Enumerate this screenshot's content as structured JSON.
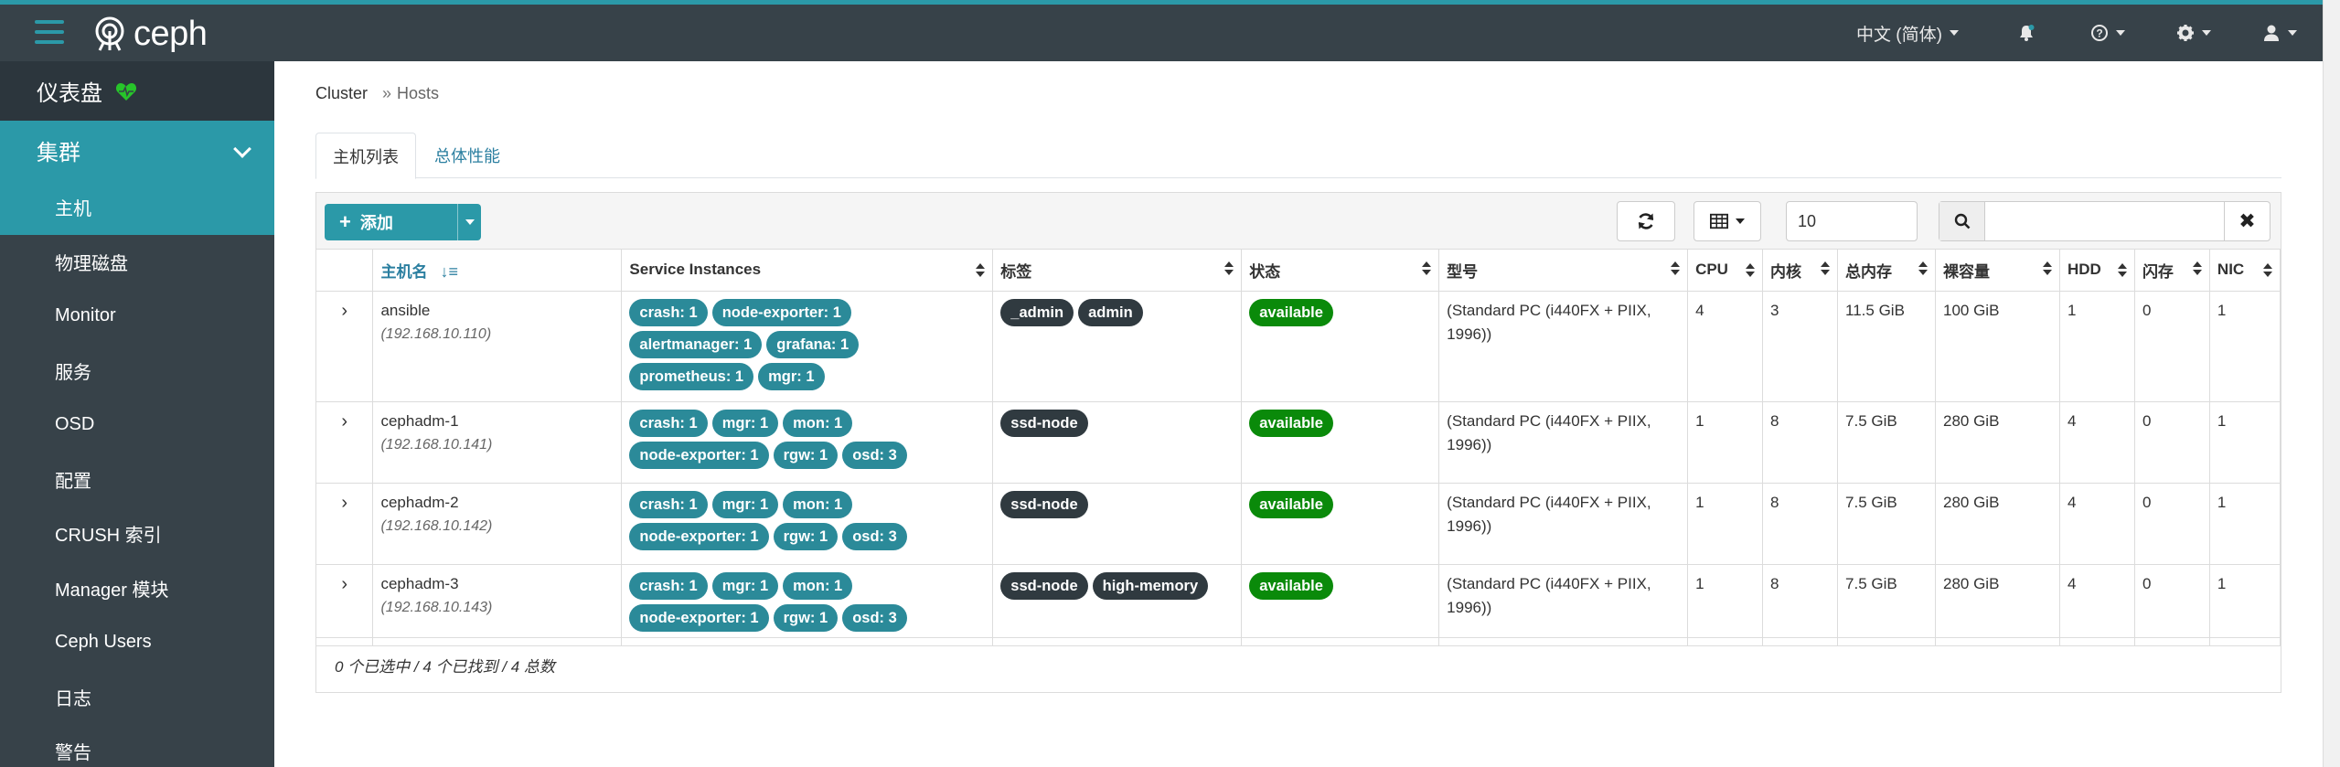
{
  "brand": {
    "name": "ceph"
  },
  "navbar": {
    "language": "中文 (简体)"
  },
  "sidebar": {
    "dashboard": "仪表盘",
    "cluster": "集群",
    "items": [
      {
        "label": "主机",
        "active": true
      },
      {
        "label": "物理磁盘"
      },
      {
        "label": "Monitor"
      },
      {
        "label": "服务"
      },
      {
        "label": "OSD"
      },
      {
        "label": "配置"
      },
      {
        "label": "CRUSH 索引"
      },
      {
        "label": "Manager 模块"
      },
      {
        "label": "Ceph Users"
      },
      {
        "label": "日志"
      },
      {
        "label": "警告"
      }
    ]
  },
  "breadcrumb": {
    "parent": "Cluster",
    "current": "Hosts"
  },
  "tabs": [
    {
      "label": "主机列表",
      "active": true
    },
    {
      "label": "总体性能"
    }
  ],
  "toolbar": {
    "add_label": "添加",
    "page_size": "10",
    "search_placeholder": ""
  },
  "table": {
    "columns": [
      "主机名",
      "Service Instances",
      "标签",
      "状态",
      "型号",
      "CPU",
      "内核",
      "总内存",
      "裸容量",
      "HDD",
      "闪存",
      "NIC"
    ],
    "rows": [
      {
        "hostname": "ansible",
        "ip": "(192.168.10.110)",
        "services": [
          "crash: 1",
          "node-exporter: 1",
          "alertmanager: 1",
          "grafana: 1",
          "prometheus: 1",
          "mgr: 1"
        ],
        "labels": [
          "_admin",
          "admin"
        ],
        "status": "available",
        "model": "(Standard PC (i440FX + PIIX, 1996))",
        "cpu": "4",
        "cores": "3",
        "memory": "11.5 GiB",
        "raw": "100 GiB",
        "hdd": "1",
        "flash": "0",
        "nic": "1"
      },
      {
        "hostname": "cephadm-1",
        "ip": "(192.168.10.141)",
        "services": [
          "crash: 1",
          "mgr: 1",
          "mon: 1",
          "node-exporter: 1",
          "rgw: 1",
          "osd: 3"
        ],
        "labels": [
          "ssd-node"
        ],
        "status": "available",
        "model": "(Standard PC (i440FX + PIIX, 1996))",
        "cpu": "1",
        "cores": "8",
        "memory": "7.5 GiB",
        "raw": "280 GiB",
        "hdd": "4",
        "flash": "0",
        "nic": "1"
      },
      {
        "hostname": "cephadm-2",
        "ip": "(192.168.10.142)",
        "services": [
          "crash: 1",
          "mgr: 1",
          "mon: 1",
          "node-exporter: 1",
          "rgw: 1",
          "osd: 3"
        ],
        "labels": [
          "ssd-node"
        ],
        "status": "available",
        "model": "(Standard PC (i440FX + PIIX, 1996))",
        "cpu": "1",
        "cores": "8",
        "memory": "7.5 GiB",
        "raw": "280 GiB",
        "hdd": "4",
        "flash": "0",
        "nic": "1"
      },
      {
        "hostname": "cephadm-3",
        "ip": "(192.168.10.143)",
        "services": [
          "crash: 1",
          "mgr: 1",
          "mon: 1",
          "node-exporter: 1",
          "rgw: 1",
          "osd: 3"
        ],
        "labels": [
          "ssd-node",
          "high-memory"
        ],
        "status": "available",
        "model": "(Standard PC (i440FX + PIIX, 1996))",
        "cpu": "1",
        "cores": "8",
        "memory": "7.5 GiB",
        "raw": "280 GiB",
        "hdd": "4",
        "flash": "0",
        "nic": "1"
      }
    ],
    "footer": "0 个已选中 / 4 个已找到 / 4 总数"
  },
  "colors": {
    "accent": "#2b99a8",
    "navbar": "#374249",
    "status_ok": "#0a8a0a",
    "label_badge": "#303a40"
  }
}
